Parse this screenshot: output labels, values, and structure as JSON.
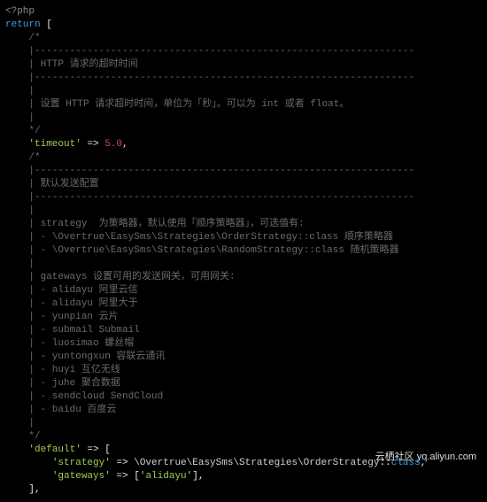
{
  "code": {
    "l01": "<?php",
    "l02a": "return",
    "l02b": " [",
    "l03": "    /*",
    "l04": "    |-----------------------------------------------------------------",
    "l05": "    | HTTP 请求的超时时间",
    "l06": "    |-----------------------------------------------------------------",
    "l07": "    |",
    "l08": "    | 设置 HTTP 请求超时时间，单位为「秒」。可以为 int 或者 float。",
    "l09": "    |",
    "l10": "    */",
    "l11a": "    ",
    "l11b": "'timeout'",
    "l11c": " => ",
    "l11d": "5.0",
    "l11e": ",",
    "l12": "    /*",
    "l13": "    |-----------------------------------------------------------------",
    "l14": "    | 默认发送配置",
    "l15": "    |-----------------------------------------------------------------",
    "l16": "    |",
    "l17": "    | strategy  为策略器，默认使用「顺序策略器」，可选值有:",
    "l18": "    | - \\Overtrue\\EasySms\\Strategies\\OrderStrategy::class 顺序策略器",
    "l19": "    | - \\Overtrue\\EasySms\\Strategies\\RandomStrategy::class 随机策略器",
    "l20": "    |",
    "l21": "    | gateways 设置可用的发送网关，可用网关:",
    "l22": "    | - alidayu 阿里云信",
    "l23": "    | - alidayu 阿里大于",
    "l24": "    | - yunpian 云片",
    "l25": "    | - submail Submail",
    "l26": "    | - luosimao 螺丝帽",
    "l27": "    | - yuntongxun 容联云通讯",
    "l28": "    | - huyi 互亿无线",
    "l29": "    | - juhe 聚合数据",
    "l30": "    | - sendcloud SendCloud",
    "l31": "    | - baidu 百度云",
    "l32": "    |",
    "l33": "    */",
    "l34a": "    ",
    "l34b": "'default'",
    "l34c": " => [",
    "l35a": "        ",
    "l35b": "'strategy'",
    "l35c": " => ",
    "l35d": "\\Overtrue\\EasySms\\Strategies\\OrderStrategy",
    "l35e": "::",
    "l35f": "class",
    "l35g": ",",
    "l36a": "        ",
    "l36b": "'gateways'",
    "l36c": " => [",
    "l36d": "'alidayu'",
    "l36e": "],",
    "l37": "    ],"
  },
  "footer": {
    "site": "云栖社区  yq.aliyun.com"
  }
}
